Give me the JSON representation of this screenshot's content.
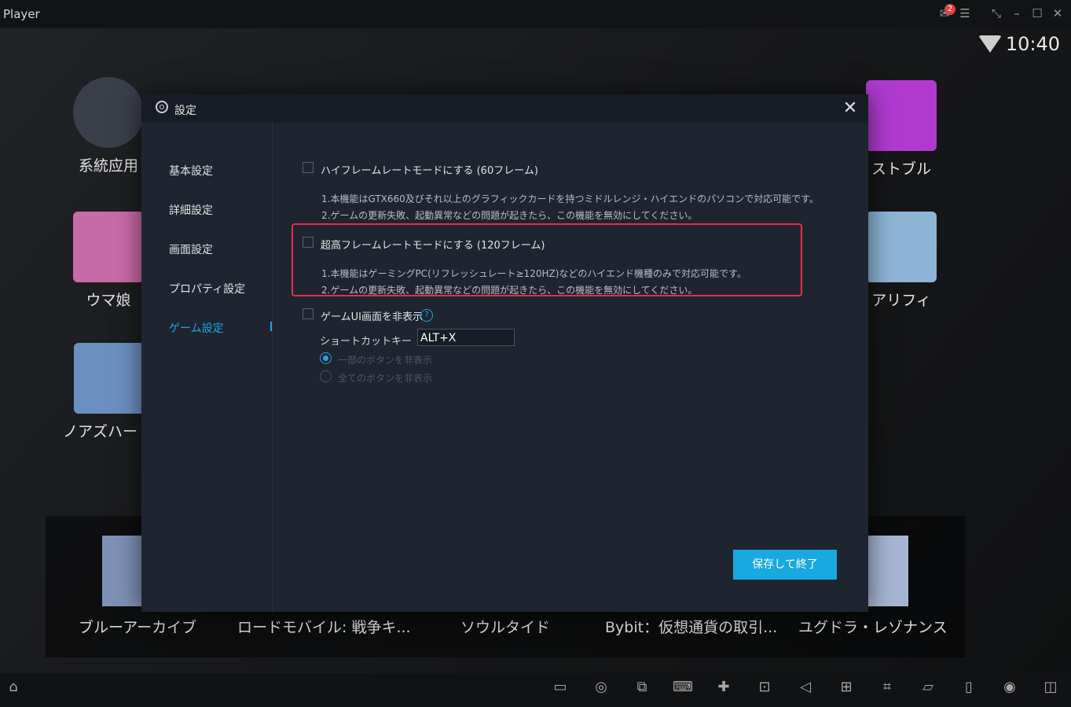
{
  "window": {
    "title": "Player",
    "mail_badge": "2",
    "time": "10:40"
  },
  "desktop": {
    "apps": [
      {
        "label": "系統应用",
        "color": "#3b3f4a"
      },
      {
        "label": "ウマ娘",
        "color": "#c96aa8"
      },
      {
        "label": "ノアズハー",
        "color": "#6b8fbf"
      },
      {
        "label": "ストブル",
        "color": "#b03ad0"
      },
      {
        "label": "アリフィ",
        "color": "#8db4d6"
      }
    ],
    "bottom_apps": [
      "ブルーアーカイブ",
      "ロードモバイル: 戦争キ...",
      "ソウルタイド",
      "Bybit：仮想通貨の取引...",
      "ユグドラ・レゾナンス"
    ]
  },
  "settings": {
    "title": "設定",
    "close": "✕",
    "nav": [
      "基本設定",
      "詳細設定",
      "画面設定",
      "プロパティ設定",
      "ゲーム設定"
    ],
    "active_nav": "ゲーム設定",
    "high_frame": {
      "label": "ハイフレームレートモードにする (60フレーム)",
      "checked": false,
      "desc1": "1.本機能はGTX660及びそれ以上のグラフィックカードを持つミドルレンジ・ハイエンドのパソコンで対応可能です。",
      "desc2": "2.ゲームの更新失敗、起動異常などの問題が起きたら、この機能を無効にしてください。"
    },
    "ultra_frame": {
      "label": "超高フレームレートモードにする (120フレーム)",
      "checked": false,
      "desc1": "1.本機能はゲーミングPC(リフレッシュレート≥120HZ)などのハイエンド機種のみで対応可能です。",
      "desc2": "2.ゲームの更新失敗、起動異常などの問題が起きたら、この機能を無効にしてください。"
    },
    "hide_ui": {
      "label": "ゲームUI画面を非表示",
      "checked": false,
      "help": "?",
      "shortcut_label": "ショートカットキー",
      "shortcut_value": "ALT+X",
      "radio1": "一部のボタンを非表示",
      "radio2": "全てのボタンを非表示",
      "radio_selected": "一部のボタンを非表示"
    },
    "save_button": "保存して終了",
    "accent": "#19a8e0",
    "highlight_color": "#e0324b"
  }
}
